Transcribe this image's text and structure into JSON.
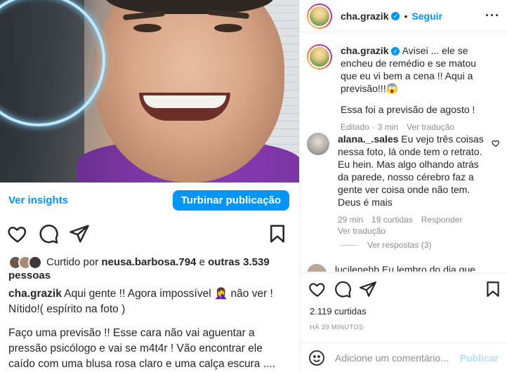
{
  "left": {
    "insights_link": "Ver insights",
    "boost_button": "Turbinar publicação",
    "liked_prefix": "Curtido por ",
    "liked_user": "neusa.barbosa.794",
    "liked_and": " e ",
    "liked_others": "outras 3.539 pessoas",
    "caption_user": "cha.grazik",
    "caption_line1": " Aqui gente !! Agora impossível 🤦‍♀️ não ver ! Nítido!( espírito na foto )",
    "caption_line2": "Faço uma previsão !! Esse cara não vai aguentar a pressão psicólogo e vai se m4t4r ! Vão encontrar ele caído com uma blusa rosa claro e uma calça escura ...."
  },
  "header": {
    "username": "cha.grazik",
    "verified": "✓",
    "separator": "•",
    "follow": "Seguir",
    "more": "···"
  },
  "comments": [
    {
      "username": "cha.grazik",
      "text": " Avisei ... ele se encheu de remédio e se matou que eu vi bem a cena !! Aqui a previsão!!!😱",
      "text2": "Essa foi a previsão de agosto !",
      "edited": "Editado",
      "time": "3 min",
      "translate": "Ver tradução"
    },
    {
      "username": "alana._.sales",
      "text": " Eu vejo três coisas nessa foto, lá onde tem o retrato. Eu hein. Mas algo olhando atrás da parede, nosso cérebro faz a gente ver coisa onde não tem. Deus é mais",
      "time": "29 min",
      "likes": "19 curtidas",
      "reply": "Responder",
      "translate": "Ver tradução",
      "view_replies": "Ver respostas (3)"
    }
  ],
  "cut_comment": "lucilenehb Eu lembro do dia que",
  "likes_count": "2.119 curtidas",
  "time_ago": "HÁ 39 MINUTOS",
  "add_comment_placeholder": "Adicione um comentário...",
  "publish": "Publicar",
  "colors": {
    "accent": "#0095f6",
    "muted": "#8e8e8e",
    "text": "#262626"
  }
}
